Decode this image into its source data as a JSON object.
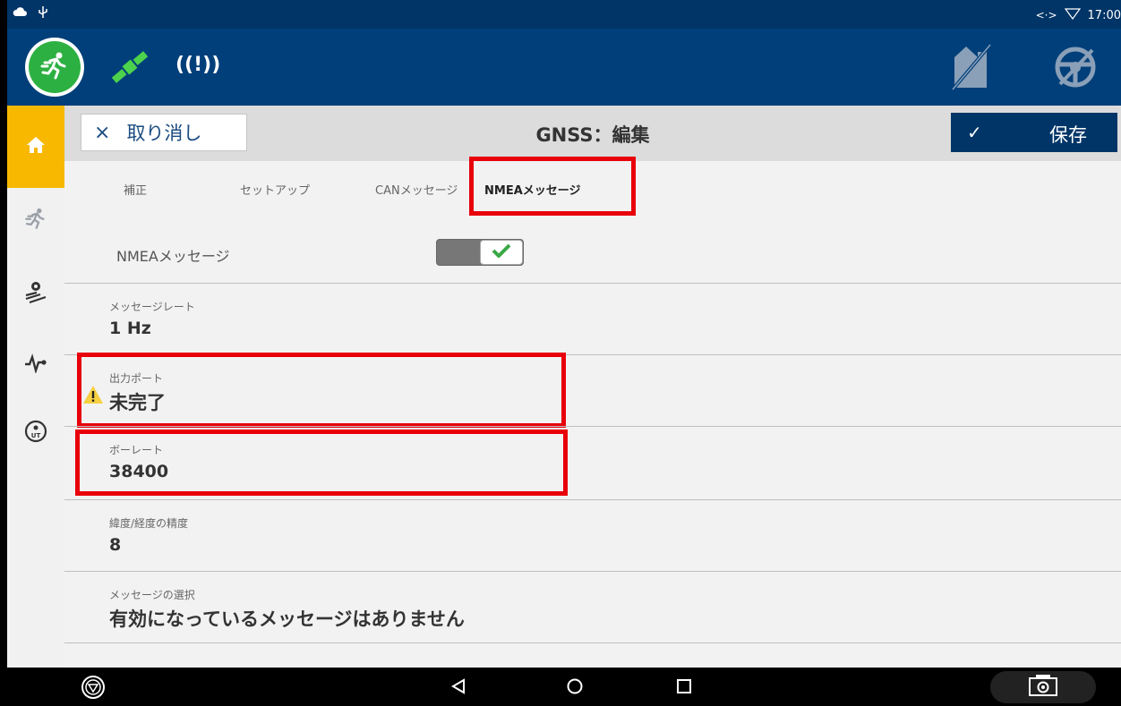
{
  "status_bar": {
    "time": "17:00",
    "left_icons": [
      "cloud-icon",
      "usb-icon"
    ],
    "right_icons": [
      "data-arrows-icon",
      "wifi-icon"
    ]
  },
  "header": {
    "signal_text": "((!))"
  },
  "nav": {
    "items": [
      "home-icon",
      "run-icon",
      "field-settings-icon",
      "pulse-icon",
      "utility-icon"
    ]
  },
  "toolbar": {
    "cancel_label": "取り消し",
    "cancel_icon": "×",
    "title": "GNSS：編集",
    "save_icon": "✓",
    "save_label": "保存"
  },
  "tabs": [
    {
      "label": "補正",
      "active": false
    },
    {
      "label": "セットアップ",
      "active": false
    },
    {
      "label": "CANメッセージ",
      "active": false
    },
    {
      "label": "NMEAメッセージ",
      "active": true
    }
  ],
  "nmea_toggle": {
    "label": "NMEAメッセージ",
    "on": true
  },
  "fields": [
    {
      "label": "メッセージレート",
      "value": "1 Hz"
    },
    {
      "label": "出力ポート",
      "value": "未完了",
      "warning": true
    },
    {
      "label": "ボーレート",
      "value": "38400"
    },
    {
      "label": "緯度/経度の精度",
      "value": "8"
    },
    {
      "label": "メッセージの選択",
      "value": "有効になっているメッセージはありません"
    }
  ],
  "colors": {
    "header": "#003f7a",
    "accent": "#f8b800",
    "highlight": "#e8000b",
    "green": "#2db042"
  }
}
